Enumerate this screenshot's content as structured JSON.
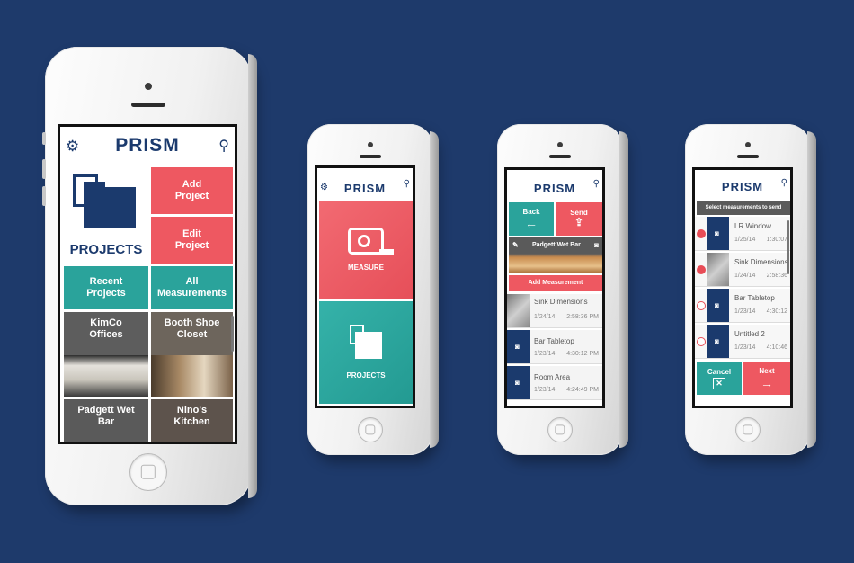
{
  "brand": {
    "logo": "PRISM",
    "bg": "#1e3a6b",
    "red": "#ee5861",
    "teal": "#2aa39b",
    "navy": "#1b3a6d"
  },
  "phone1": {
    "header_icons": [
      "gear-icon",
      "search-icon"
    ],
    "projects_label": "PROJECTS",
    "add_project": "Add Project",
    "edit_project": "Edit Project",
    "recent_projects": "Recent Projects",
    "all_measurements": "All Measurements",
    "kimco": "KimCo Offices",
    "booth": "Booth Shoe Closet",
    "padgett": "Padgett Wet Bar",
    "ninos": "Nino's Kitchen"
  },
  "phone2": {
    "measure": "MEASURE",
    "projects": "PROJECTS"
  },
  "phone3": {
    "back": "Back",
    "send": "Send",
    "project_name": "Padgett Wet Bar",
    "add_measurement": "Add Measurement",
    "rows": [
      {
        "name": "Sink Dimensions",
        "date": "1/24/14",
        "time": "2:58:36 PM"
      },
      {
        "name": "Bar Tabletop",
        "date": "1/23/14",
        "time": "4:30:12 PM"
      },
      {
        "name": "Room Area",
        "date": "1/23/14",
        "time": "4:24:49 PM"
      }
    ]
  },
  "phone4": {
    "banner": "Select measurements to send",
    "rows": [
      {
        "name": "LR Window",
        "date": "1/25/14",
        "time": "1:30:07",
        "selected": true
      },
      {
        "name": "Sink Dimensions",
        "date": "1/24/14",
        "time": "2:58:36",
        "selected": true
      },
      {
        "name": "Bar Tabletop",
        "date": "1/23/14",
        "time": "4:30:12",
        "selected": false
      },
      {
        "name": "Untitled 2",
        "date": "1/23/14",
        "time": "4:10:46",
        "selected": false
      }
    ],
    "cancel": "Cancel",
    "next": "Next"
  }
}
